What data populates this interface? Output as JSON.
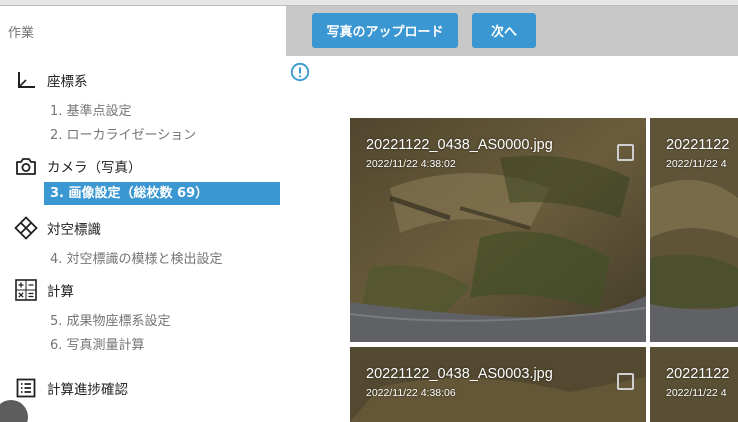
{
  "sidebar": {
    "title": "作業",
    "sections": [
      {
        "label": "座標系",
        "icon": "axis-icon",
        "items": [
          {
            "label": "1. 基準点設定"
          },
          {
            "label": "2. ローカライゼーション"
          }
        ]
      },
      {
        "label": "カメラ（写真）",
        "icon": "camera-icon",
        "items": [
          {
            "label": "3. 画像設定（総枚数 69）",
            "active": true
          }
        ]
      },
      {
        "label": "対空標識",
        "icon": "target-marker-icon",
        "items": [
          {
            "label": "4. 対空標識の模様と検出設定"
          }
        ]
      },
      {
        "label": "計算",
        "icon": "calculator-icon",
        "items": [
          {
            "label": "5. 成果物座標系設定"
          },
          {
            "label": "6. 写真測量計算"
          }
        ]
      },
      {
        "label": "計算進捗確認",
        "icon": "list-icon",
        "items": []
      }
    ]
  },
  "toolbar": {
    "upload_label": "写真のアップロード",
    "next_label": "次へ"
  },
  "info": {
    "icon": "info-icon"
  },
  "photos": [
    {
      "filename": "20221122_0438_AS0000.jpg",
      "datetime": "2022/11/22 4:38:02"
    },
    {
      "filename": "20221122",
      "datetime": "2022/11/22 4"
    },
    {
      "filename": "20221122_0438_AS0003.jpg",
      "datetime": "2022/11/22 4:38:06"
    },
    {
      "filename": "20221122",
      "datetime": "2022/11/22 4"
    }
  ],
  "colors": {
    "accent": "#3a97d1",
    "toolbar": "#c8c8c8"
  }
}
